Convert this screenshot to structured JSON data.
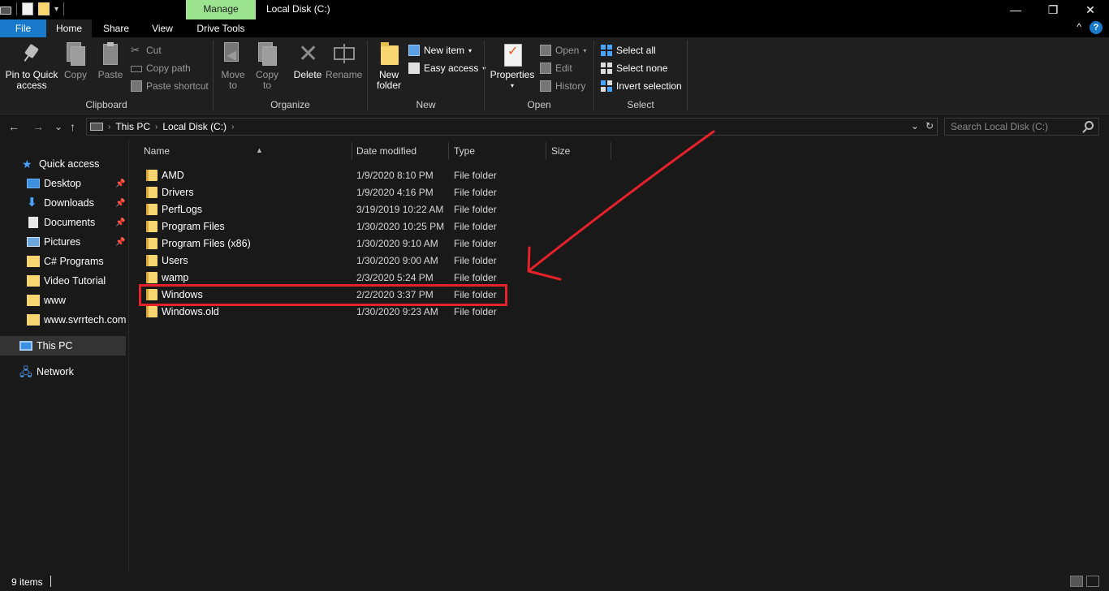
{
  "titlebar": {
    "manage_tab": "Manage",
    "window_title": "Local Disk (C:)",
    "minimize": "—",
    "maximize": "❐",
    "close": "✕"
  },
  "tabs": {
    "file": "File",
    "home": "Home",
    "share": "Share",
    "view": "View",
    "drive_tools": "Drive Tools",
    "collapse_ribbon": "^",
    "help": "?"
  },
  "ribbon": {
    "clipboard": {
      "label": "Clipboard",
      "pin_line1": "Pin to Quick",
      "pin_line2": "access",
      "copy": "Copy",
      "paste": "Paste",
      "cut": "Cut",
      "copy_path": "Copy path",
      "paste_shortcut": "Paste shortcut"
    },
    "organize": {
      "label": "Organize",
      "move_to_line1": "Move",
      "move_to_line2": "to",
      "copy_to_line1": "Copy",
      "copy_to_line2": "to",
      "delete": "Delete",
      "rename": "Rename"
    },
    "new": {
      "label": "New",
      "new_folder_line1": "New",
      "new_folder_line2": "folder",
      "new_item": "New item",
      "easy_access": "Easy access"
    },
    "open": {
      "label": "Open",
      "properties": "Properties",
      "open": "Open",
      "edit": "Edit",
      "history": "History"
    },
    "select": {
      "label": "Select",
      "select_all": "Select all",
      "select_none": "Select none",
      "invert_selection": "Invert selection"
    }
  },
  "address": {
    "back": "←",
    "forward": "→",
    "recent": "⌄",
    "up": "↑",
    "crumbs": [
      "This PC",
      "Local Disk (C:)"
    ],
    "search_placeholder": "Search Local Disk (C:)"
  },
  "nav": {
    "quick_access": "Quick access",
    "items": [
      {
        "label": "Desktop",
        "icon": "desktop-icon",
        "pinned": true
      },
      {
        "label": "Downloads",
        "icon": "download-icon",
        "pinned": true
      },
      {
        "label": "Documents",
        "icon": "documents-icon",
        "pinned": true
      },
      {
        "label": "Pictures",
        "icon": "pictures-icon",
        "pinned": true
      },
      {
        "label": "C# Programs",
        "icon": "folder-icon",
        "pinned": false
      },
      {
        "label": "Video Tutorial",
        "icon": "folder-icon",
        "pinned": false
      },
      {
        "label": "www",
        "icon": "folder-icon",
        "pinned": false
      },
      {
        "label": "www.svrrtech.com",
        "icon": "folder-icon",
        "pinned": false
      }
    ],
    "this_pc": "This PC",
    "network": "Network"
  },
  "columns": {
    "name": "Name",
    "date_modified": "Date modified",
    "type": "Type",
    "size": "Size"
  },
  "files": [
    {
      "name": "AMD",
      "date": "1/9/2020 8:10 PM",
      "type": "File folder"
    },
    {
      "name": "Drivers",
      "date": "1/9/2020 4:16 PM",
      "type": "File folder"
    },
    {
      "name": "PerfLogs",
      "date": "3/19/2019 10:22 AM",
      "type": "File folder"
    },
    {
      "name": "Program Files",
      "date": "1/30/2020 10:25 PM",
      "type": "File folder"
    },
    {
      "name": "Program Files (x86)",
      "date": "1/30/2020 9:10 AM",
      "type": "File folder"
    },
    {
      "name": "Users",
      "date": "1/30/2020 9:00 AM",
      "type": "File folder"
    },
    {
      "name": "wamp",
      "date": "2/3/2020 5:24 PM",
      "type": "File folder"
    },
    {
      "name": "Windows",
      "date": "2/2/2020 3:37 PM",
      "type": "File folder"
    },
    {
      "name": "Windows.old",
      "date": "1/30/2020 9:23 AM",
      "type": "File folder"
    }
  ],
  "status": {
    "item_count": "9 items"
  },
  "colors": {
    "accent": "#1979ca",
    "manage_tab": "#9ce48f",
    "annotation": "#e5212a",
    "folder": "#f7d671"
  }
}
